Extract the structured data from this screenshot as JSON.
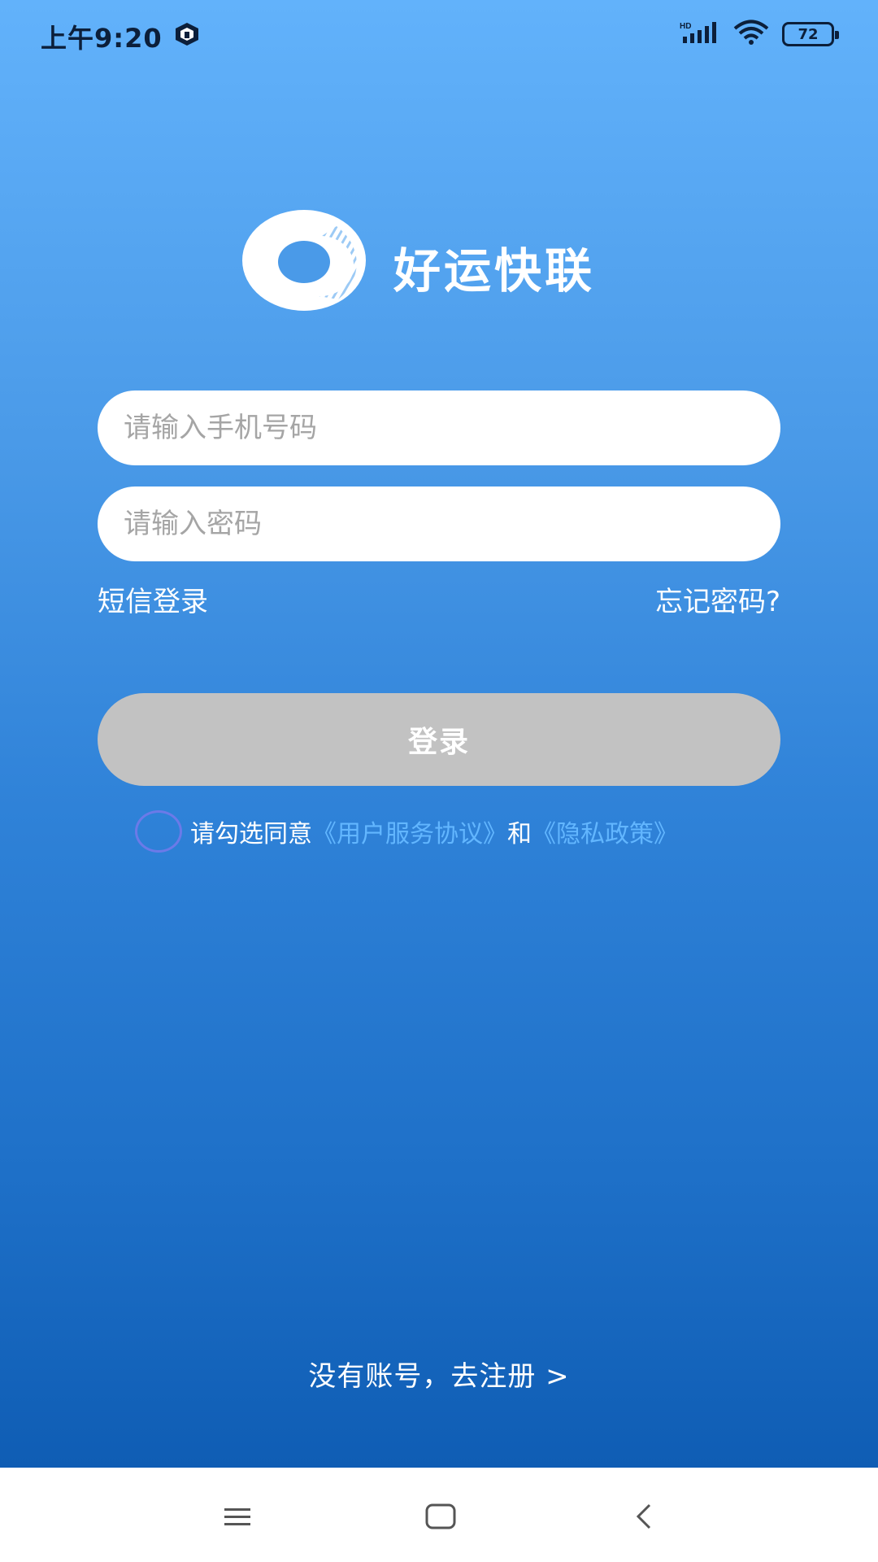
{
  "status_bar": {
    "time": "上午9:20",
    "network": "HD",
    "battery": "72"
  },
  "app": {
    "name": "好运快联"
  },
  "login_form": {
    "phone_placeholder": "请输入手机号码",
    "password_placeholder": "请输入密码",
    "sms_login": "短信登录",
    "forgot_password": "忘记密码?",
    "login_button": "登录"
  },
  "agreement": {
    "prefix": "请勾选同意",
    "service_link": "《用户服务协议》",
    "and": "和",
    "privacy_link": "《隐私政策》",
    "checked": false
  },
  "register": {
    "label": "没有账号，去注册 >"
  },
  "colors": {
    "gradient_top": "#62b2fb",
    "gradient_bottom": "#0f5db4",
    "login_button_disabled": "#c2c2c2",
    "agreement_link": "#62b6ff",
    "checkbox_border": "#6b7ae8"
  },
  "icons": {
    "status_app": "app-notification-icon",
    "signal": "signal-icon",
    "wifi": "wifi-icon",
    "battery": "battery-icon",
    "logo": "ring-logo-icon",
    "nav_menu": "menu-icon",
    "nav_home": "home-square-icon",
    "nav_back": "back-chevron-icon"
  }
}
